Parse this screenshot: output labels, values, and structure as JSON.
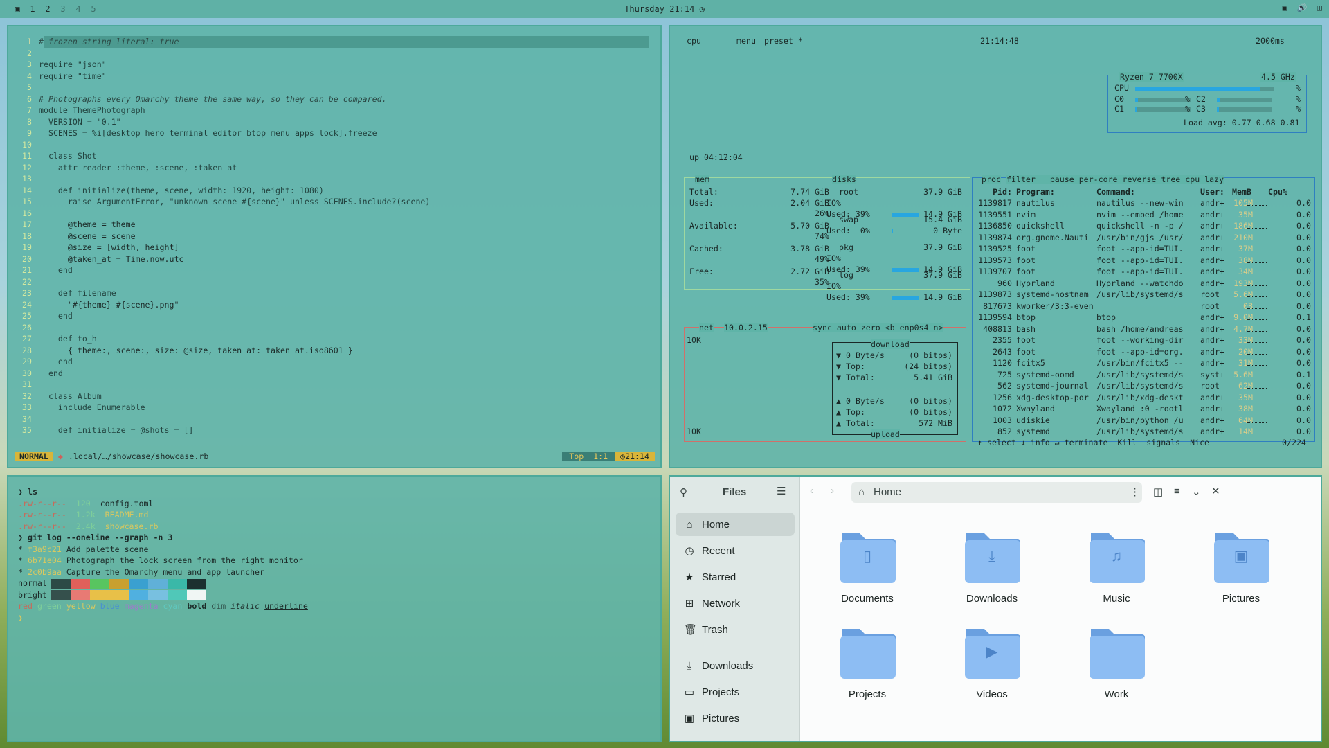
{
  "topbar": {
    "workspaces": [
      "1",
      "2",
      "3",
      "4",
      "5"
    ],
    "clock": "Thursday 21:14"
  },
  "editor": {
    "lines": [
      {
        "n": "1",
        "t": "# frozen_string_literal: true"
      },
      {
        "n": "2",
        "t": ""
      },
      {
        "n": "3",
        "t": "require \"json\""
      },
      {
        "n": "4",
        "t": "require \"time\""
      },
      {
        "n": "5",
        "t": ""
      },
      {
        "n": "6",
        "t": "# Photographs every Omarchy theme the same way, so they can be compared."
      },
      {
        "n": "7",
        "t": "module ThemePhotograph"
      },
      {
        "n": "8",
        "t": "  VERSION = \"0.1\""
      },
      {
        "n": "9",
        "t": "  SCENES = %i[desktop hero terminal editor btop menu apps lock].freeze"
      },
      {
        "n": "10",
        "t": ""
      },
      {
        "n": "11",
        "t": "  class Shot"
      },
      {
        "n": "12",
        "t": "    attr_reader :theme, :scene, :taken_at"
      },
      {
        "n": "13",
        "t": ""
      },
      {
        "n": "14",
        "t": "    def initialize(theme, scene, width: 1920, height: 1080)"
      },
      {
        "n": "15",
        "t": "      raise ArgumentError, \"unknown scene #{scene}\" unless SCENES.include?(scene)"
      },
      {
        "n": "16",
        "t": ""
      },
      {
        "n": "17",
        "t": "      @theme = theme"
      },
      {
        "n": "18",
        "t": "      @scene = scene"
      },
      {
        "n": "19",
        "t": "      @size = [width, height]"
      },
      {
        "n": "20",
        "t": "      @taken_at = Time.now.utc"
      },
      {
        "n": "21",
        "t": "    end"
      },
      {
        "n": "22",
        "t": ""
      },
      {
        "n": "23",
        "t": "    def filename"
      },
      {
        "n": "24",
        "t": "      \"#{theme} #{scene}.png\""
      },
      {
        "n": "25",
        "t": "    end"
      },
      {
        "n": "26",
        "t": ""
      },
      {
        "n": "27",
        "t": "    def to_h"
      },
      {
        "n": "28",
        "t": "      { theme:, scene:, size: @size, taken_at: taken_at.iso8601 }"
      },
      {
        "n": "29",
        "t": "    end"
      },
      {
        "n": "30",
        "t": "  end"
      },
      {
        "n": "31",
        "t": ""
      },
      {
        "n": "32",
        "t": "  class Album"
      },
      {
        "n": "33",
        "t": "    include Enumerable"
      },
      {
        "n": "34",
        "t": ""
      },
      {
        "n": "35",
        "t": "    def initialize = @shots = []"
      }
    ],
    "mode": "NORMAL",
    "path": ".local/…/showcase/showcase.rb",
    "pos_top": "Top",
    "pos": "1:1",
    "time": "21:14"
  },
  "btop": {
    "header": {
      "cpu": "cpu",
      "menu": "menu",
      "preset": "preset *",
      "time": "21:14:48",
      "interval": "2000ms"
    },
    "cpu": {
      "model": "Ryzen 7 7700X",
      "freq": "4.5 GHz",
      "rows": [
        {
          "l": "CPU",
          "pct": 0.9
        },
        {
          "l": "C0",
          "pct": 0.05
        },
        {
          "l": "C1",
          "pct": 0.04
        },
        {
          "l": "C2",
          "pct": 0.05
        },
        {
          "l": "C3",
          "pct": 0.04
        }
      ],
      "load": "Load avg: 0.77 0.68 0.81",
      "uptime": "up 04:12:04"
    },
    "mem": {
      "title": "mem",
      "total": "7.74 GiB",
      "used": "2.04 GiB",
      "used_pct": "26%",
      "available": "5.70 GiB",
      "avail_pct": "74%",
      "cached": "3.78 GiB",
      "cached_pct": "49%",
      "free": "2.72 GiB",
      "free_pct": "35%"
    },
    "disks": {
      "title": "disks",
      "items": [
        {
          "name": "root",
          "size": "37.9 GiB",
          "io": "IO%",
          "used": "Used: 39%",
          "val": "14.9 GiB",
          "pct": 0.39
        },
        {
          "name": "swap",
          "size": "15.4 GiB",
          "io": "",
          "used": "Used:  0%",
          "val": "0 Byte",
          "pct": 0.0
        },
        {
          "name": "pkg",
          "size": "37.9 GiB",
          "io": "IO%",
          "used": "Used: 39%",
          "val": "14.9 GiB",
          "pct": 0.39
        },
        {
          "name": "log",
          "size": "37.9 GiB",
          "io": "IO%",
          "used": "Used: 39%",
          "val": "14.9 GiB",
          "pct": 0.39
        }
      ]
    },
    "net": {
      "title": "net",
      "ip": "10.0.2.15",
      "tags": "sync auto zero <b enp0s4 n>",
      "scale_top": "10K",
      "scale_bot": "10K",
      "download": {
        "label": "download",
        "rate": "0 Byte/s",
        "bits": "(0 bitps)",
        "top": "Top:",
        "top_bits": "(24 bitps)",
        "total": "Total:",
        "total_val": "5.41 GiB"
      },
      "upload": {
        "label": "upload",
        "rate": "0 Byte/s",
        "bits": "(0 bitps)",
        "top": "Top:",
        "top_bits": "(0 bitps)",
        "total": "Total:",
        "total_val": "572 MiB"
      }
    },
    "proc": {
      "title": "proc",
      "tabs": "filter   pause per-core reverse tree cpu lazy",
      "cols": {
        "pid": "Pid:",
        "prog": "Program:",
        "cmd": "Command:",
        "user": "User:",
        "mem": "MemB",
        "cpu": "Cpu%"
      },
      "rows": [
        [
          "1139817",
          "nautilus",
          "nautilus --new-win",
          "andr+",
          "105M",
          "0.0"
        ],
        [
          "1139551",
          "nvim",
          "nvim --embed /home",
          "andr+",
          "35M",
          "0.0"
        ],
        [
          "1136850",
          "quickshell",
          "quickshell -n -p /",
          "andr+",
          "186M",
          "0.0"
        ],
        [
          "1139874",
          "org.gnome.Nauti",
          "/usr/bin/gjs /usr/",
          "andr+",
          "210M",
          "0.0"
        ],
        [
          "1139525",
          "foot",
          "foot --app-id=TUI.",
          "andr+",
          "37M",
          "0.0"
        ],
        [
          "1139573",
          "foot",
          "foot --app-id=TUI.",
          "andr+",
          "38M",
          "0.0"
        ],
        [
          "1139707",
          "foot",
          "foot --app-id=TUI.",
          "andr+",
          "34M",
          "0.0"
        ],
        [
          "960",
          "Hyprland",
          "Hyprland --watchdo",
          "andr+",
          "193M",
          "0.0"
        ],
        [
          "1139873",
          "systemd-hostnam",
          "/usr/lib/systemd/s",
          "root",
          "5.6M",
          "0.0"
        ],
        [
          "817673",
          "kworker/3:3-even",
          "",
          "root",
          "0B",
          "0.0"
        ],
        [
          "1139594",
          "btop",
          "btop",
          "andr+",
          "9.0M",
          "0.1"
        ],
        [
          "408813",
          "bash",
          "bash /home/andreas",
          "andr+",
          "4.7M",
          "0.0"
        ],
        [
          "2355",
          "foot",
          "foot --working-dir",
          "andr+",
          "33M",
          "0.0"
        ],
        [
          "2643",
          "foot",
          "foot --app-id=org.",
          "andr+",
          "20M",
          "0.0"
        ],
        [
          "1120",
          "fcitx5",
          "/usr/bin/fcitx5 --",
          "andr+",
          "31M",
          "0.0"
        ],
        [
          "725",
          "systemd-oomd",
          "/usr/lib/systemd/s",
          "syst+",
          "5.6M",
          "0.1"
        ],
        [
          "562",
          "systemd-journal",
          "/usr/lib/systemd/s",
          "root",
          "62M",
          "0.0"
        ],
        [
          "1256",
          "xdg-desktop-por",
          "/usr/lib/xdg-deskt",
          "andr+",
          "35M",
          "0.0"
        ],
        [
          "1072",
          "Xwayland",
          "Xwayland :0 -rootl",
          "andr+",
          "38M",
          "0.0"
        ],
        [
          "1003",
          "udiskie",
          "/usr/bin/python /u",
          "andr+",
          "64M",
          "0.0"
        ],
        [
          "852",
          "systemd",
          "/usr/lib/systemd/s",
          "andr+",
          "14M",
          "0.0"
        ]
      ],
      "footer": "↑ select ↓ info ↵ terminate  Kill  signals  Nice",
      "count": "0/224"
    }
  },
  "terminal": {
    "ls_cmd": "ls",
    "files": [
      {
        "perm": ".rw-r--r--",
        "size": "120",
        "name": "config.toml"
      },
      {
        "perm": ".rw-r--r--",
        "size": "1.2k",
        "name": "README.md"
      },
      {
        "perm": ".rw-r--r--",
        "size": "2.4k",
        "name": "showcase.rb"
      }
    ],
    "git_cmd": "git log --oneline --graph -n 3",
    "commits": [
      {
        "hash": "f3a9c21",
        "msg": "Add palette scene"
      },
      {
        "hash": "6b71e04",
        "msg": "Photograph the lock screen from the right monitor"
      },
      {
        "hash": "2c0b9aa",
        "msg": "Capture the Omarchy menu and app launcher"
      }
    ],
    "normal_label": "normal",
    "bright_label": "bright",
    "normal_colors": [
      "#2c4a46",
      "#e0605a",
      "#58c560",
      "#c8a030",
      "#3aa0d0",
      "#60b0d8",
      "#3ab8a8",
      "#1c3030"
    ],
    "bright_colors": [
      "#35504c",
      "#e87a74",
      "#e8c048",
      "#e8c048",
      "#50b0e0",
      "#78c0e0",
      "#50c8b8",
      "#f0f6f4"
    ],
    "styles": {
      "red": "red",
      "green": "green",
      "yellow": "yellow",
      "blue": "blue",
      "magenta": "magenta",
      "cyan": "cyan",
      "bold": "bold",
      "dim": "dim",
      "italic": "italic",
      "underline": "underline"
    }
  },
  "files": {
    "title": "Files",
    "location": "Home",
    "sidebar": [
      {
        "label": "Home",
        "icon": "home-icon"
      },
      {
        "label": "Recent",
        "icon": "clock-icon"
      },
      {
        "label": "Starred",
        "icon": "star-icon"
      },
      {
        "label": "Network",
        "icon": "network-icon"
      },
      {
        "label": "Trash",
        "icon": "trash-icon"
      }
    ],
    "bookmarks": [
      {
        "label": "Downloads",
        "icon": "download-icon"
      },
      {
        "label": "Projects",
        "icon": "folder-icon"
      },
      {
        "label": "Pictures",
        "icon": "image-icon"
      }
    ],
    "folders": [
      {
        "label": "Documents",
        "glyph": "document"
      },
      {
        "label": "Downloads",
        "glyph": "download"
      },
      {
        "label": "Music",
        "glyph": "music"
      },
      {
        "label": "Pictures",
        "glyph": "picture"
      },
      {
        "label": "Projects",
        "glyph": ""
      },
      {
        "label": "Videos",
        "glyph": "video"
      },
      {
        "label": "Work",
        "glyph": ""
      }
    ]
  }
}
